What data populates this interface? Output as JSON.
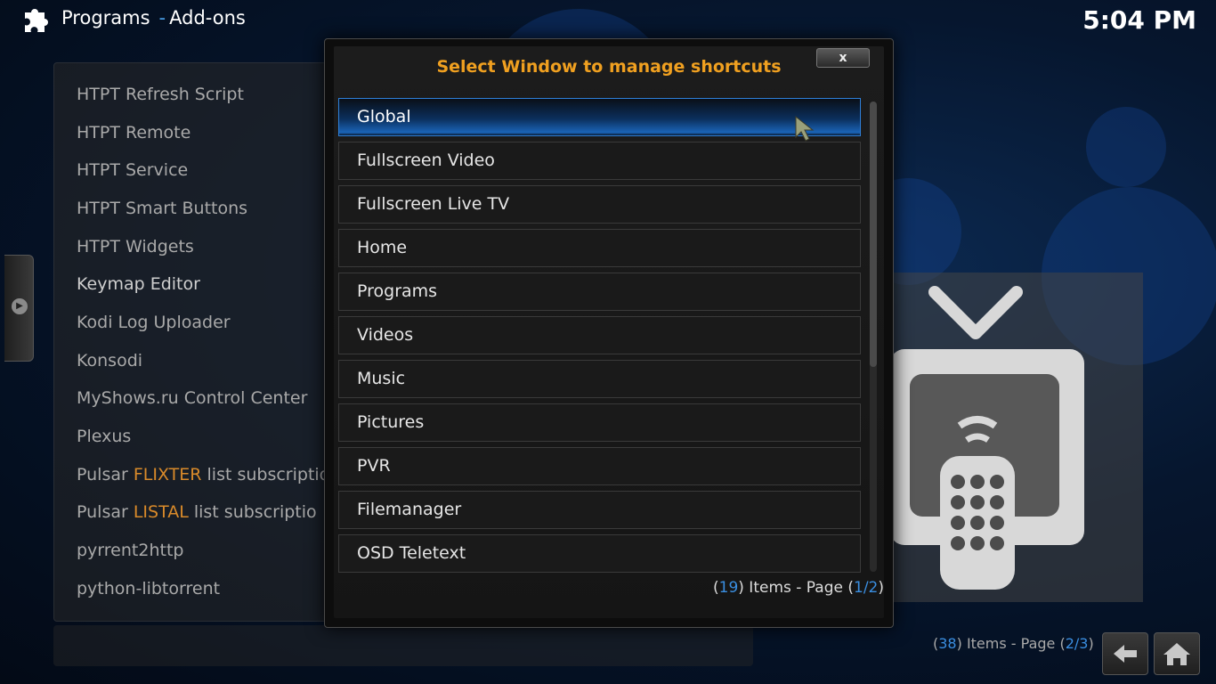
{
  "header": {
    "section": "Programs",
    "subsection": "Add-ons",
    "clock": "5:04 PM",
    "icon": "puzzle-icon"
  },
  "background_list": {
    "items": [
      {
        "label": "HTPT Refresh Script"
      },
      {
        "label": "HTPT Remote"
      },
      {
        "label": "HTPT Service"
      },
      {
        "label": "HTPT Smart Buttons"
      },
      {
        "label": "HTPT Widgets"
      },
      {
        "label": "Keymap Editor"
      },
      {
        "label": "Kodi Log Uploader"
      },
      {
        "label": "Konsodi"
      },
      {
        "label": "MyShows.ru Control Center"
      },
      {
        "label": "Plexus"
      },
      {
        "label_pre": "Pulsar ",
        "label_accent": "FLIXTER",
        "label_post": " list subscriptio"
      },
      {
        "label_pre": "Pulsar ",
        "label_accent": "LISTAL",
        "label_post": "  list subscriptio"
      },
      {
        "label": "pyrrent2http"
      },
      {
        "label": "python-libtorrent"
      }
    ],
    "count_open": "(",
    "count": "38",
    "count_text": ") Items - Page (",
    "page": "2/3",
    "page_close": ")"
  },
  "dialog": {
    "title": "Select Window to manage shortcuts",
    "close_label": "x",
    "items": [
      {
        "label": "Global"
      },
      {
        "label": "Fullscreen Video"
      },
      {
        "label": "Fullscreen Live TV"
      },
      {
        "label": "Home"
      },
      {
        "label": "Programs"
      },
      {
        "label": "Videos"
      },
      {
        "label": "Music"
      },
      {
        "label": "Pictures"
      },
      {
        "label": "PVR"
      },
      {
        "label": "Filemanager"
      },
      {
        "label": "OSD Teletext"
      }
    ],
    "selected_index": 0,
    "count_open": "(",
    "count": "19",
    "count_text": ") Items - Page (",
    "page": "1/2",
    "page_close": ")"
  },
  "colors": {
    "accent_blue": "#3a8ee0",
    "title_orange": "#f0a020",
    "highlight_orange": "#d98a2a"
  }
}
